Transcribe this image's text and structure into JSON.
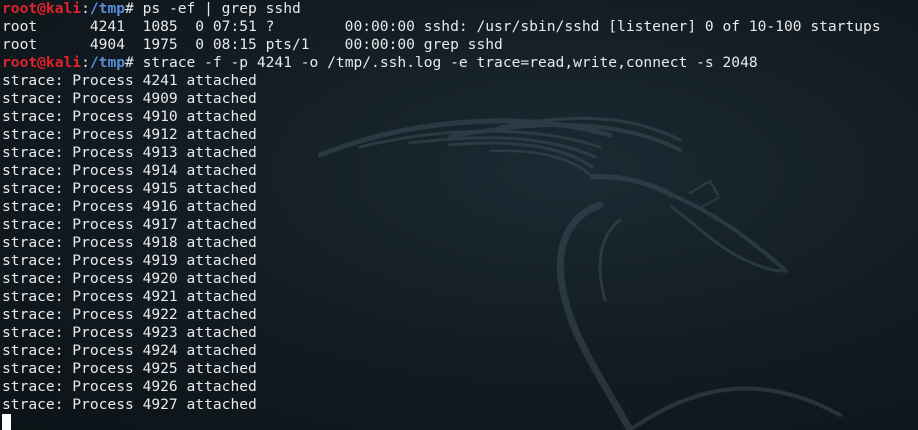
{
  "prompt": {
    "user_host": "root@kali",
    "sep": ":",
    "cwd": "/tmp",
    "symbol": "# "
  },
  "commands": [
    "ps -ef | grep sshd",
    "strace -f -p 4241 -o /tmp/.ssh.log -e trace=read,write,connect -s 2048"
  ],
  "ps_output": [
    "root      4241  1085  0 07:51 ?        00:00:00 sshd: /usr/sbin/sshd [listener] 0 of 10-100 startups",
    "root      4904  1975  0 08:15 pts/1    00:00:00 grep sshd"
  ],
  "strace_output": [
    "strace: Process 4241 attached",
    "strace: Process 4909 attached",
    "strace: Process 4910 attached",
    "strace: Process 4912 attached",
    "strace: Process 4913 attached",
    "strace: Process 4914 attached",
    "strace: Process 4915 attached",
    "strace: Process 4916 attached",
    "strace: Process 4917 attached",
    "strace: Process 4918 attached",
    "strace: Process 4919 attached",
    "strace: Process 4920 attached",
    "strace: Process 4921 attached",
    "strace: Process 4922 attached",
    "strace: Process 4923 attached",
    "strace: Process 4924 attached",
    "strace: Process 4925 attached",
    "strace: Process 4926 attached",
    "strace: Process 4927 attached"
  ],
  "background_icon": "kali-dragon-icon",
  "colors": {
    "prompt_user": "#e2222a",
    "prompt_path": "#5a8fd6",
    "text": "#e8eaec",
    "background": "#131d24"
  }
}
